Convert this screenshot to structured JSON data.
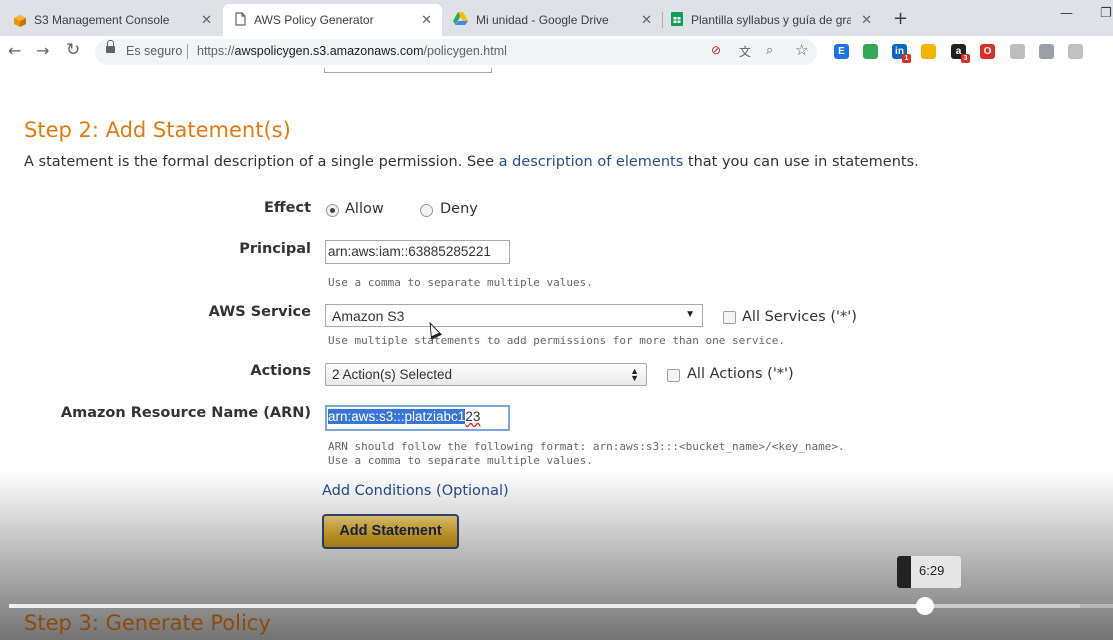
{
  "browser": {
    "tabs": [
      {
        "title": "S3 Management Console",
        "icon": "aws-cube-icon",
        "color": "#f29100"
      },
      {
        "title": "AWS Policy Generator",
        "icon": "page-icon"
      },
      {
        "title": "Mi unidad - Google Drive",
        "icon": "google-drive-icon"
      },
      {
        "title": "Plantilla syllabus y guía de graba",
        "icon": "google-sheets-icon",
        "color": "#0f9d58"
      }
    ],
    "active_tab_index": 1,
    "address": {
      "secure_label": "Es seguro",
      "url_prefix": "https://",
      "url_host": "awspolicygen.s3.amazonaws.com",
      "url_path": "/policygen.html"
    },
    "extensions": [
      {
        "name": "extension-e-icon",
        "letter": "E",
        "color": "#1a73e8"
      },
      {
        "name": "extension-inbox-icon",
        "letter": "",
        "color": "#34a853"
      },
      {
        "name": "extension-linkedin-icon",
        "letter": "in",
        "color": "#0a66c2",
        "badge": "1"
      },
      {
        "name": "extension-drive-triangle-icon",
        "letter": "",
        "color": "#f4b400"
      },
      {
        "name": "extension-a-icon",
        "letter": "a",
        "color": "#222222",
        "badge": "3"
      },
      {
        "name": "extension-opera-icon",
        "letter": "O",
        "color": "#d93025"
      },
      {
        "name": "extension-doc-icon",
        "letter": "",
        "color": "#bdbdbd"
      },
      {
        "name": "extension-cloud-icon",
        "letter": "",
        "color": "#9aa0a6"
      },
      {
        "name": "extension-circle-icon",
        "letter": "",
        "color": "#c0c0c0"
      }
    ]
  },
  "step2": {
    "title": "Step 2: Add Statement(s)",
    "intro_before": "A statement is the formal description of a single permission. See ",
    "intro_link": "a description of elements",
    "intro_after": " that you can use in statements."
  },
  "form": {
    "effect": {
      "label": "Effect",
      "options": [
        "Allow",
        "Deny"
      ],
      "selected": "Allow"
    },
    "principal": {
      "label": "Principal",
      "value": "arn:aws:iam::63885285221",
      "hint": "Use a comma to separate multiple values."
    },
    "aws_service": {
      "label": "AWS Service",
      "value": "Amazon S3",
      "all_label": "All Services ('*')",
      "hint": "Use multiple statements to add permissions for more than one service."
    },
    "actions": {
      "label": "Actions",
      "value": "2 Action(s) Selected",
      "all_label": "All Actions ('*')"
    },
    "arn": {
      "label": "Amazon Resource Name (ARN)",
      "value_selected": "arn:aws:s3:::platziabc1",
      "value_rest": "23",
      "hint1": "ARN should follow the following format: arn:aws:s3:::<bucket_name>/<key_name>.",
      "hint2": "Use a comma to separate multiple values."
    },
    "add_conditions": "Add Conditions (Optional)",
    "add_statement": "Add Statement"
  },
  "step3": {
    "title": "Step 3: Generate Policy"
  },
  "video": {
    "tooltip_time": "6:29",
    "progress_fraction": 0.83,
    "buffered_fraction": 0.97
  }
}
